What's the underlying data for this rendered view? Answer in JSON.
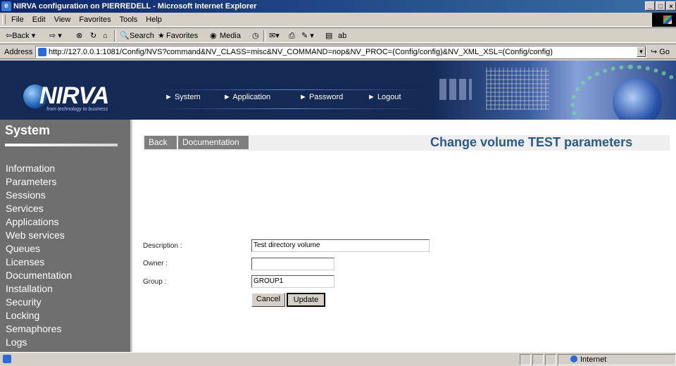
{
  "window": {
    "title": "NIRVA configuration on PIERREDELL - Microsoft Internet Explorer",
    "controls": [
      "0",
      "1",
      "r"
    ]
  },
  "menu": [
    "File",
    "Edit",
    "View",
    "Favorites",
    "Tools",
    "Help"
  ],
  "toolbar": {
    "back": "⇦Back ▾",
    "forward": "⇨ ▾",
    "stop": "⊗",
    "refresh": "↻",
    "home": "⌂",
    "search": "Search",
    "favorites": "Favorites",
    "media": "Media",
    "history": "◷",
    "mail": "✉▾",
    "print": "⎙",
    "edit": "✎ ▾",
    "discuss": "▤",
    "messenger": "ab"
  },
  "address": {
    "label": "Address",
    "url": "http://127.0.0.1:1081/Config/NVS?command&NV_CLASS=misc&NV_COMMAND=nop&NV_PROC=(Config/config)&NV_XML_XSL=(Config/config)",
    "go": "Go"
  },
  "header": {
    "logo": "NIRVA",
    "tagline": "from technology to business",
    "nav": [
      "► System",
      "► Application",
      "► Password",
      "► Logout"
    ]
  },
  "sidebar": {
    "title": "System",
    "items": [
      "Information",
      "Parameters",
      "Sessions",
      "Services",
      "Applications",
      "Web services",
      "Queues",
      "Licenses",
      "Documentation",
      "Installation",
      "Security",
      "Locking",
      "Semaphores",
      "Logs"
    ]
  },
  "content": {
    "back_label": "Back",
    "doc_label": "Documentation",
    "title": "Change volume TEST parameters",
    "fields": [
      {
        "label": "Description :",
        "value": "Test directory volume"
      },
      {
        "label": "Owner :",
        "value": ""
      },
      {
        "label": "Group :",
        "value": "GROUP1"
      }
    ],
    "cancel_label": "Cancel",
    "update_label": "Update"
  },
  "status": {
    "zone": "Internet"
  }
}
